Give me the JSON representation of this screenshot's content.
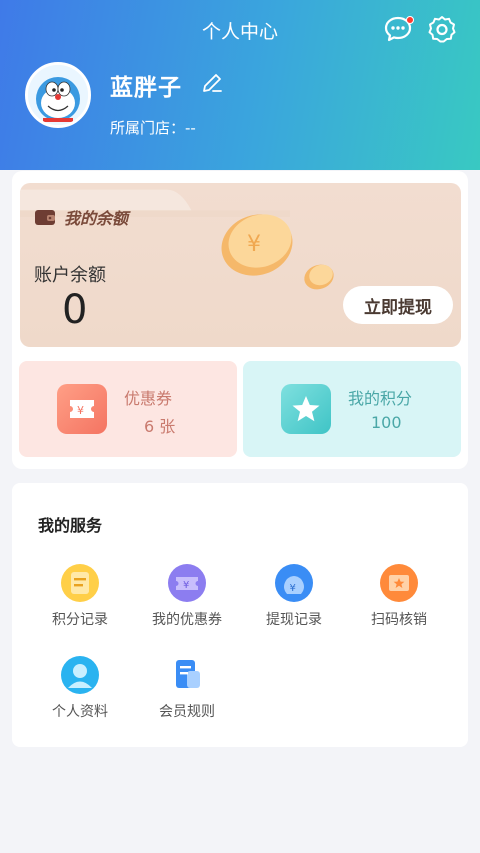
{
  "header": {
    "title": "个人中心",
    "user_name": "蓝胖子",
    "store_label": "所属门店：--",
    "message_icon": "chat-bubble-icon",
    "settings_icon": "gear-icon"
  },
  "balance": {
    "title": "我的余额",
    "label": "账户余额",
    "amount": "0",
    "withdraw_label": "立即提现"
  },
  "stats": {
    "coupon": {
      "label": "优惠券",
      "value": "6 张",
      "icon": "ticket-icon"
    },
    "points": {
      "label": "我的积分",
      "value": "100",
      "icon": "star-icon"
    }
  },
  "services": {
    "title": "我的服务",
    "items": [
      {
        "label": "积分记录",
        "icon": "points-record-icon"
      },
      {
        "label": "我的优惠券",
        "icon": "coupon-icon"
      },
      {
        "label": "提现记录",
        "icon": "withdraw-record-icon"
      },
      {
        "label": "扫码核销",
        "icon": "scan-verify-icon"
      },
      {
        "label": "个人资料",
        "icon": "profile-icon"
      },
      {
        "label": "会员规则",
        "icon": "member-rules-icon"
      }
    ]
  },
  "colors": {
    "header_start": "#3f7ae8",
    "header_end": "#39c9c2",
    "notification_dot": "#ff3b30"
  }
}
